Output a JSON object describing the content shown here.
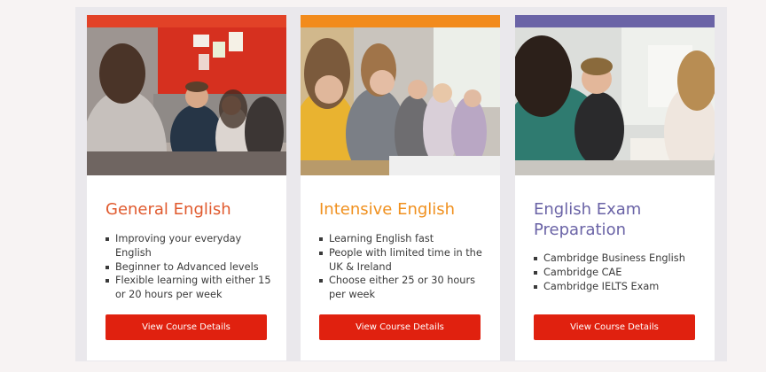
{
  "colors": {
    "page_background": "#f7f3f3",
    "panel_background": "#eae8ec",
    "button": "#e0210f"
  },
  "courses": [
    {
      "title": "General English",
      "accent": "#e24227",
      "title_color": "#e05a2e",
      "bullets": [
        "Improving your everyday English",
        "Beginner to Advanced levels",
        "Flexible learning with either 15 or 20 hours per week"
      ],
      "button_label": "View Course Details",
      "photo": "students-classroom-photo"
    },
    {
      "title": "Intensive English",
      "accent": "#f28b1c",
      "title_color": "#f0901e",
      "bullets": [
        "Learning English fast",
        "People with limited time in the UK & Ireland",
        "Choose either 25 or 30 hours per week"
      ],
      "button_label": "View Course Details",
      "photo": "students-classroom-photo"
    },
    {
      "title": "English Exam Preparation",
      "accent": "#6a63a6",
      "title_color": "#6a63a6",
      "bullets": [
        "Cambridge Business English",
        "Cambridge CAE",
        "Cambridge IELTS Exam"
      ],
      "button_label": "View Course Details",
      "photo": "students-classroom-photo"
    }
  ]
}
